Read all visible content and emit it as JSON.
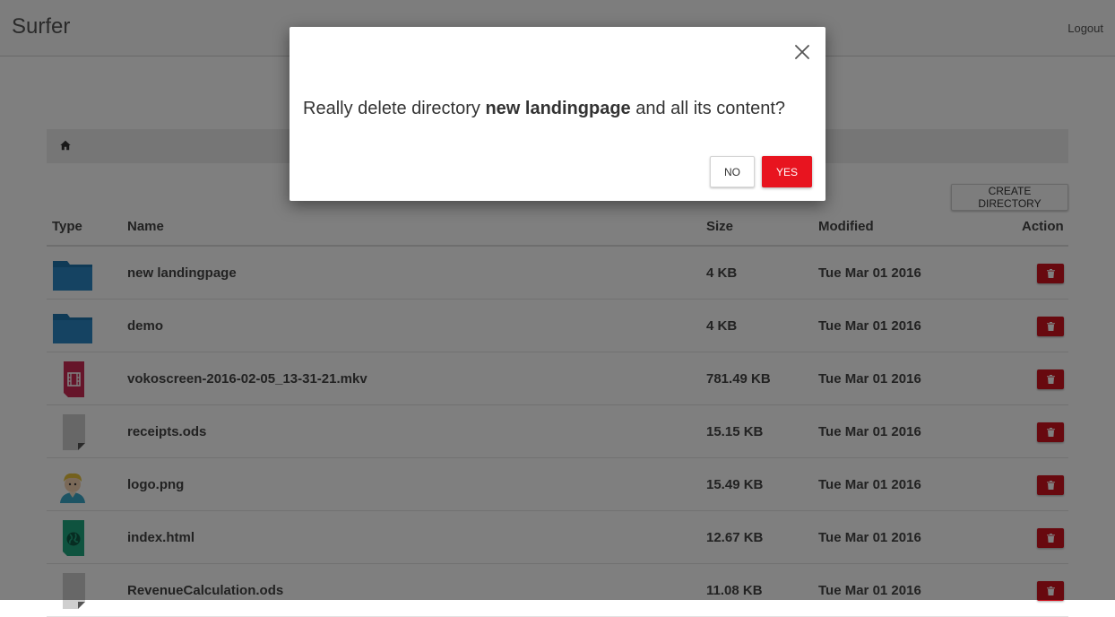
{
  "app": {
    "brand": "Surfer",
    "logout_label": "Logout"
  },
  "toolbar": {
    "create_directory_label": "CREATE DIRECTORY"
  },
  "table": {
    "headers": {
      "type": "Type",
      "name": "Name",
      "size": "Size",
      "modified": "Modified",
      "action": "Action"
    },
    "rows": [
      {
        "icon": "folder-icon",
        "name": "new landingpage",
        "size": "4 KB",
        "modified": "Tue Mar 01 2016"
      },
      {
        "icon": "folder-icon",
        "name": "demo",
        "size": "4 KB",
        "modified": "Tue Mar 01 2016"
      },
      {
        "icon": "video-file-icon",
        "name": "vokoscreen-2016-02-05_13-31-21.mkv",
        "size": "781.49 KB",
        "modified": "Tue Mar 01 2016"
      },
      {
        "icon": "generic-file-icon",
        "name": "receipts.ods",
        "size": "15.15 KB",
        "modified": "Tue Mar 01 2016"
      },
      {
        "icon": "image-file-icon",
        "name": "logo.png",
        "size": "15.49 KB",
        "modified": "Tue Mar 01 2016"
      },
      {
        "icon": "html-file-icon",
        "name": "index.html",
        "size": "12.67 KB",
        "modified": "Tue Mar 01 2016"
      },
      {
        "icon": "generic-file-icon",
        "name": "RevenueCalculation.ods",
        "size": "11.08 KB",
        "modified": "Tue Mar 01 2016"
      }
    ]
  },
  "dialog": {
    "message_prefix": "Really delete directory ",
    "directory_name": "new landingpage",
    "message_suffix": " and all its content?",
    "no_label": "NO",
    "yes_label": "YES"
  },
  "colors": {
    "danger": "#d0121e",
    "yes_button": "#e8141f",
    "folder": "#2a86c4",
    "overlay": "rgba(0,0,0,0.5)"
  }
}
